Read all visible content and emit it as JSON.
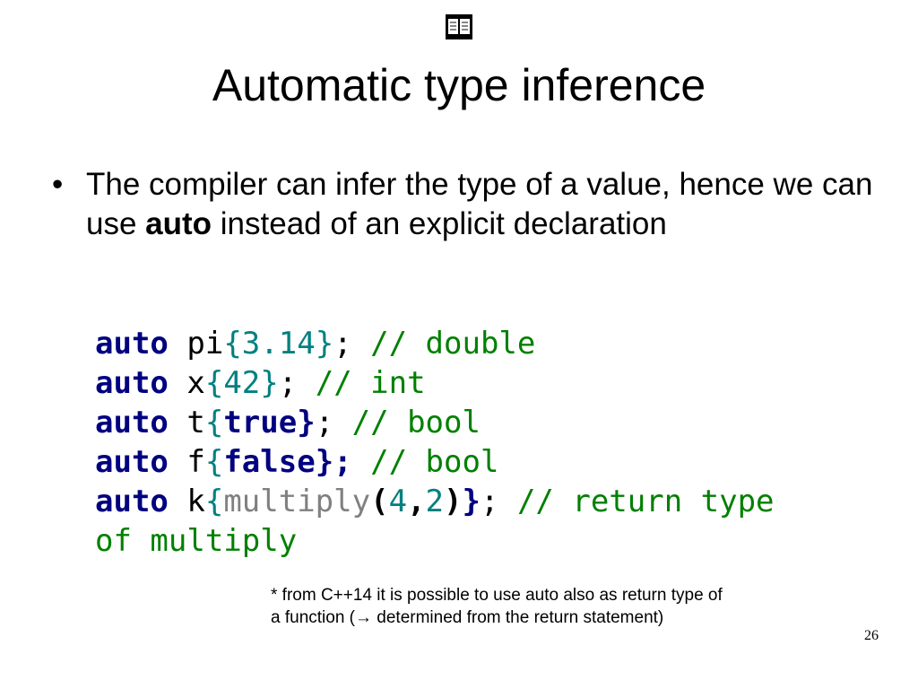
{
  "slide": {
    "title": "Automatic type inference",
    "icon": "book-icon",
    "bullet": {
      "marker": "•",
      "text_before": "The compiler can infer the type of a value, hence we can use ",
      "bold": "auto",
      "text_after": " instead of an explicit declaration"
    },
    "code_lines": [
      [
        "auto",
        " pi",
        "{",
        "3.14",
        "}",
        ";",
        " // double"
      ],
      [
        "auto",
        " x",
        "{",
        "42",
        "}",
        ";",
        " // int"
      ],
      [
        "auto",
        " t",
        "{",
        "true",
        "}",
        ";",
        " // bool"
      ],
      [
        "auto",
        " f",
        "{",
        "false",
        "}",
        ";",
        " // bool"
      ],
      [
        "auto",
        " k",
        "{",
        "multiply",
        "(",
        "4",
        ",",
        "2",
        ")",
        "}",
        ";",
        " // return type"
      ],
      [
        "of multiply"
      ]
    ],
    "footnote_line1": "* from C++14 it is possible to use auto also as return type of",
    "footnote_line2": "a function (→ determined from the return statement)",
    "page_number": "26"
  }
}
